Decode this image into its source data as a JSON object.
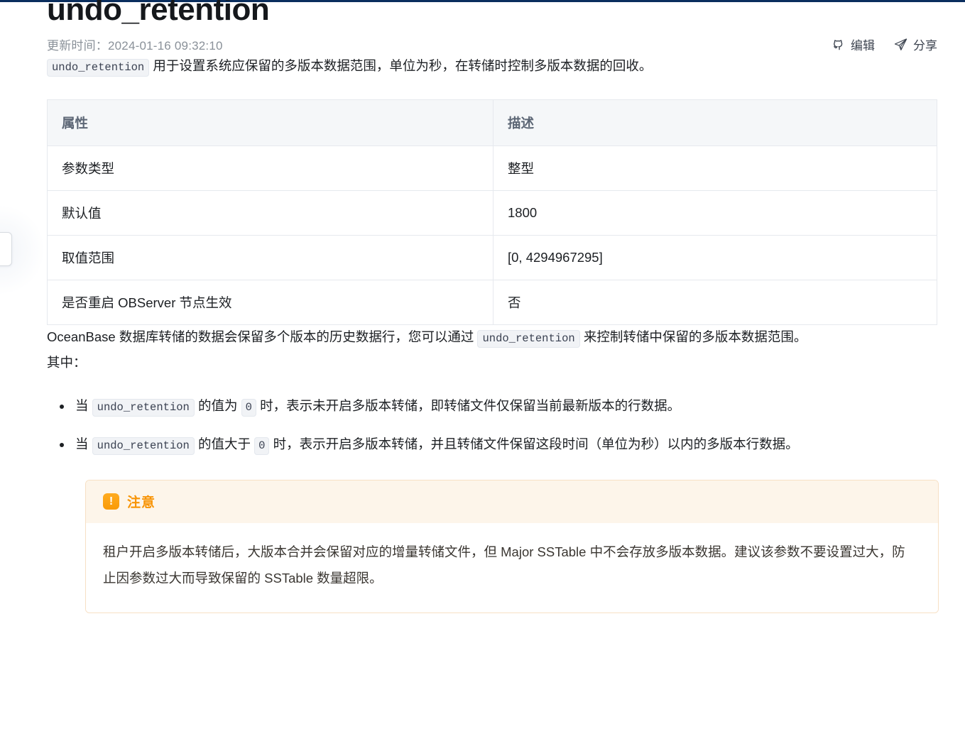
{
  "page": {
    "title": "undo_retention",
    "updated_label": "更新时间：",
    "updated_value": "2024-01-16 09:32:10"
  },
  "actions": [
    {
      "label": "编辑",
      "icon": "github-icon"
    },
    {
      "label": "分享",
      "icon": "share-paper-plane-icon"
    }
  ],
  "intro": {
    "code": "undo_retention",
    "text": "用于设置系统应保留的多版本数据范围，单位为秒，在转储时控制多版本数据的回收。"
  },
  "table": {
    "headers": [
      "属性",
      "描述"
    ],
    "rows": [
      {
        "attr": "参数类型",
        "desc": "整型"
      },
      {
        "attr": "默认值",
        "desc": "1800"
      },
      {
        "attr": "取值范围",
        "desc": "[0, 4294967295]"
      },
      {
        "attr": "是否重启 OBServer 节点生效",
        "desc": "否"
      }
    ]
  },
  "body": {
    "para_part1": "OceanBase 数据库转储的数据会保留多个版本的历史数据行，您可以通过 ",
    "para_code": "undo_retention",
    "para_part2": " 来控制转储中保留的多版本数据范围。",
    "qizhong": "其中："
  },
  "bullets": [
    {
      "part1": "当 ",
      "code1": "undo_retention",
      "part2": " 的值为 ",
      "code2": "0",
      "part3": " 时，表示未开启多版本转储，即转储文件仅保留当前最新版本的行数据。"
    },
    {
      "part1": "当 ",
      "code1": "undo_retention",
      "part2": " 的值大于 ",
      "code2": "0",
      "part3": " 时，表示开启多版本转储，并且转储文件保留这段时间（单位为秒）以内的多版本行数据。"
    }
  ],
  "notice": {
    "icon_glyph": "!",
    "title": "注意",
    "text": "租户开启多版本转储后，大版本合并会保留对应的增量转储文件，但 Major SSTable 中不会存放多版本数据。建议该参数不要设置过大，防止因参数过大而导致保留的 SSTable 数量超限。",
    "accent_color": "#f89406",
    "background_color": "#fdf5ea"
  }
}
